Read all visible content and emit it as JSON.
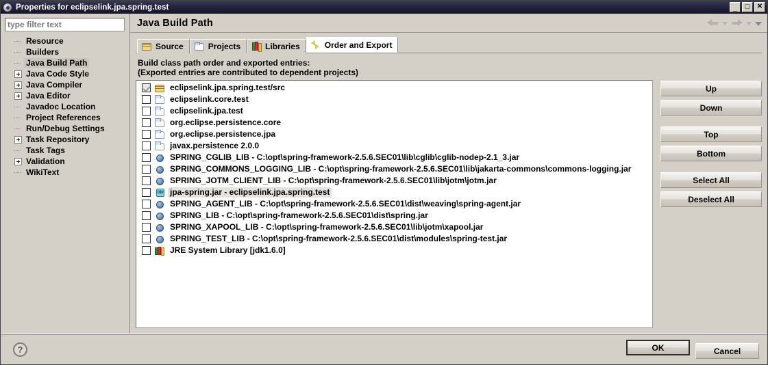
{
  "window": {
    "title": "Properties for eclipselink.jpa.spring.test",
    "icon": "eclipse-properties-icon",
    "controls": [
      {
        "name": "minimize-button",
        "glyph": "_"
      },
      {
        "name": "maximize-button",
        "glyph": "□"
      },
      {
        "name": "close-button",
        "glyph": "✕"
      }
    ]
  },
  "filter": {
    "placeholder": "type filter text",
    "value": ""
  },
  "tree": {
    "items": [
      {
        "label": "Resource",
        "expandable": false,
        "selected": false
      },
      {
        "label": "Builders",
        "expandable": false,
        "selected": false
      },
      {
        "label": "Java Build Path",
        "expandable": false,
        "selected": true
      },
      {
        "label": "Java Code Style",
        "expandable": true,
        "selected": false
      },
      {
        "label": "Java Compiler",
        "expandable": true,
        "selected": false
      },
      {
        "label": "Java Editor",
        "expandable": true,
        "selected": false
      },
      {
        "label": "Javadoc Location",
        "expandable": false,
        "selected": false
      },
      {
        "label": "Project References",
        "expandable": false,
        "selected": false
      },
      {
        "label": "Run/Debug Settings",
        "expandable": false,
        "selected": false
      },
      {
        "label": "Task Repository",
        "expandable": true,
        "selected": false
      },
      {
        "label": "Task Tags",
        "expandable": false,
        "selected": false
      },
      {
        "label": "Validation",
        "expandable": true,
        "selected": false
      },
      {
        "label": "WikiText",
        "expandable": false,
        "selected": false
      }
    ]
  },
  "page": {
    "title": "Java Build Path",
    "nav": {
      "back": "back-arrow",
      "back_menu": "back-history-dropdown",
      "forward": "forward-arrow",
      "forward_menu": "forward-history-dropdown",
      "menu": "view-menu-dropdown"
    }
  },
  "tabs": [
    {
      "label": "Source",
      "icon": "package-icon",
      "active": false
    },
    {
      "label": "Projects",
      "icon": "folder-icon",
      "active": false
    },
    {
      "label": "Libraries",
      "icon": "books-icon",
      "active": false
    },
    {
      "label": "Order and Export",
      "icon": "order-arrows-icon",
      "active": true
    }
  ],
  "description": {
    "line1": "Build class path order and exported entries:",
    "line2": "(Exported entries are contributed to dependent projects)"
  },
  "entries": [
    {
      "label": "eclipselink.jpa.spring.test/src",
      "icon": "source-folder-icon",
      "checked": true,
      "selected": false
    },
    {
      "label": "eclipselink.core.test",
      "icon": "project-folder-icon",
      "checked": false,
      "selected": false
    },
    {
      "label": "eclipselink.jpa.test",
      "icon": "project-folder-icon",
      "checked": false,
      "selected": false
    },
    {
      "label": "org.eclipse.persistence.core",
      "icon": "project-folder-icon",
      "checked": false,
      "selected": false
    },
    {
      "label": "org.eclipse.persistence.jpa",
      "icon": "project-folder-icon",
      "checked": false,
      "selected": false
    },
    {
      "label": "javax.persistence 2.0.0",
      "icon": "project-folder-icon",
      "checked": false,
      "selected": false
    },
    {
      "label": "SPRING_CGLIB_LIB - C:\\opt\\spring-framework-2.5.6.SEC01\\lib\\cglib\\cglib-nodep-2.1_3.jar",
      "icon": "library-icon",
      "checked": false,
      "selected": false
    },
    {
      "label": "SPRING_COMMONS_LOGGING_LIB - C:\\opt\\spring-framework-2.5.6.SEC01\\lib\\jakarta-commons\\commons-logging.jar",
      "icon": "library-icon",
      "checked": false,
      "selected": false
    },
    {
      "label": "SPRING_JOTM_CLIENT_LIB - C:\\opt\\spring-framework-2.5.6.SEC01\\lib\\jotm\\jotm.jar",
      "icon": "library-icon",
      "checked": false,
      "selected": false
    },
    {
      "label": "jpa-spring.jar - eclipselink.jpa.spring.test",
      "icon": "jar-icon",
      "checked": false,
      "selected": true
    },
    {
      "label": "SPRING_AGENT_LIB - C:\\opt\\spring-framework-2.5.6.SEC01\\dist\\weaving\\spring-agent.jar",
      "icon": "library-icon",
      "checked": false,
      "selected": false
    },
    {
      "label": "SPRING_LIB - C:\\opt\\spring-framework-2.5.6.SEC01\\dist\\spring.jar",
      "icon": "library-icon",
      "checked": false,
      "selected": false
    },
    {
      "label": "SPRING_XAPOOL_LIB - C:\\opt\\spring-framework-2.5.6.SEC01\\lib\\jotm\\xapool.jar",
      "icon": "library-icon",
      "checked": false,
      "selected": false
    },
    {
      "label": "SPRING_TEST_LIB - C:\\opt\\spring-framework-2.5.6.SEC01\\dist\\modules\\spring-test.jar",
      "icon": "library-icon",
      "checked": false,
      "selected": false
    },
    {
      "label": "JRE System Library [jdk1.6.0]",
      "icon": "jre-library-icon",
      "checked": false,
      "selected": false
    }
  ],
  "side_buttons": {
    "up": "Up",
    "down": "Down",
    "top": "Top",
    "bottom": "Bottom",
    "select_all": "Select All",
    "deselect_all": "Deselect All"
  },
  "footer": {
    "help": "?",
    "ok": "OK",
    "cancel": "Cancel"
  },
  "colors": {
    "panel_bg": "#d4d0c8",
    "list_bg": "#ffffff",
    "titlebar_bg": "#24243c",
    "selection_bg": "#e4e2de",
    "tree_selection_bg": "#c8c4bc"
  }
}
